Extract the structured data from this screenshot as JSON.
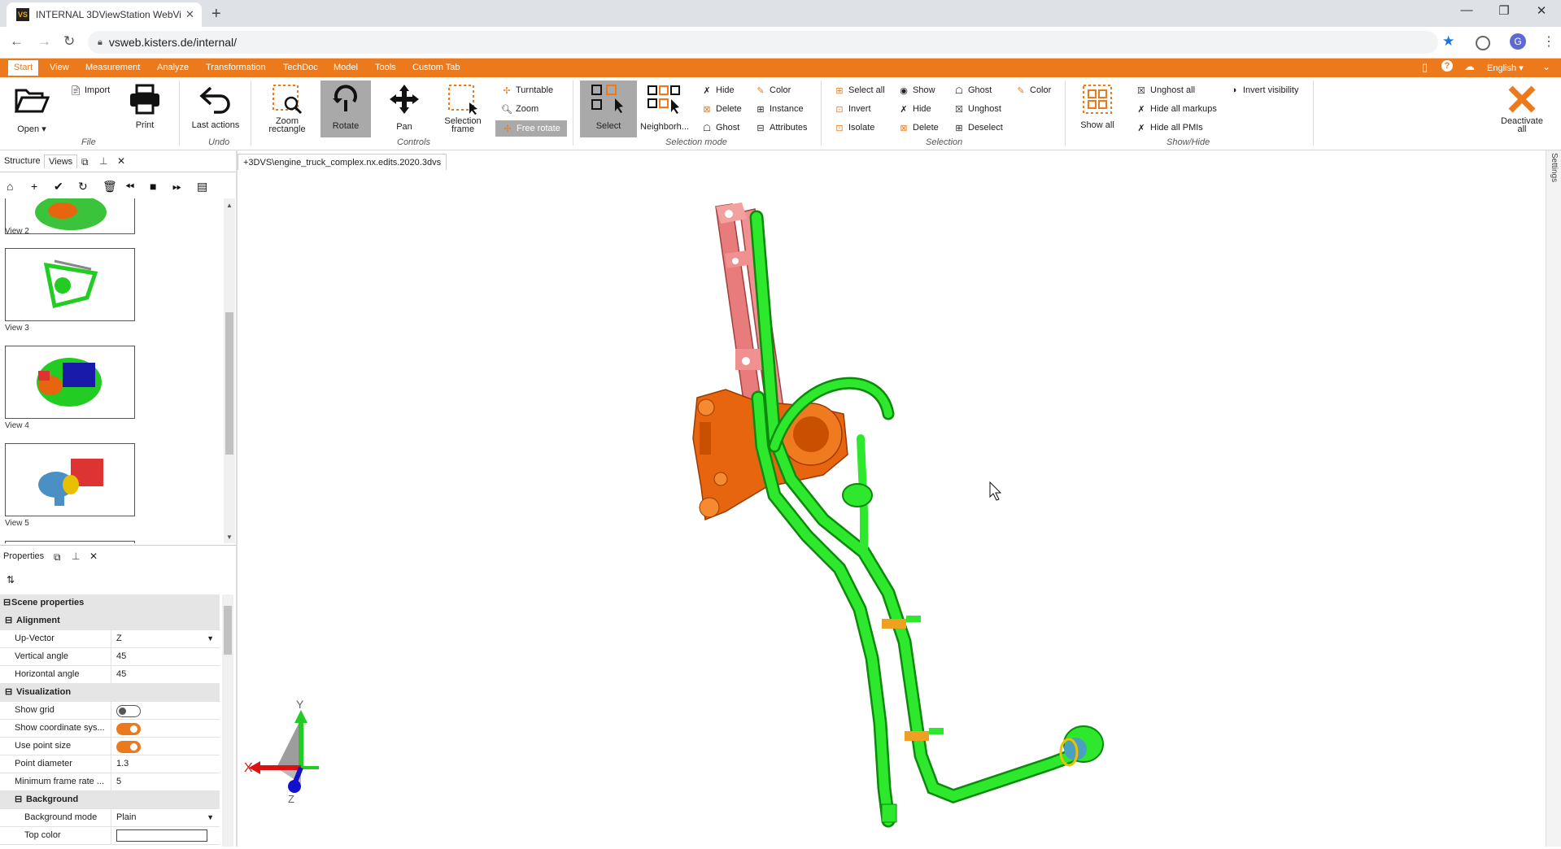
{
  "browser": {
    "tab_title": "INTERNAL 3DViewStation WebVi",
    "favicon_text": "VS",
    "url": "vsweb.kisters.de/internal/",
    "profile_initial": "G"
  },
  "menu": [
    "Start",
    "View",
    "Measurement",
    "Analyze",
    "Transformation",
    "TechDoc",
    "Model",
    "Tools",
    "Custom Tab"
  ],
  "menu_right": {
    "language": "English"
  },
  "ribbon": {
    "open": "Open",
    "import": "Import",
    "print": "Print",
    "file_group": "File",
    "last_actions": "Last actions",
    "undo_group": "Undo",
    "zoom_rectangle": "Zoom rectangle",
    "rotate": "Rotate",
    "pan": "Pan",
    "selection_frame": "Selection frame",
    "turntable": "Turntable",
    "zoom": "Zoom",
    "free_rotate": "Free rotate",
    "controls_group": "Controls",
    "select": "Select",
    "neighborh": "Neighborh...",
    "hide": "Hide",
    "delete": "Delete",
    "ghost": "Ghost",
    "color": "Color",
    "instance": "Instance",
    "attributes": "Attributes",
    "selection_mode_group": "Selection mode",
    "select_all": "Select all",
    "invert": "Invert",
    "isolate": "Isolate",
    "show": "Show",
    "hide2": "Hide",
    "delete2": "Delete",
    "ghost2": "Ghost",
    "unghost": "Unghost",
    "deselect": "Deselect",
    "color2": "Color",
    "selection_group": "Selection",
    "show_all": "Show all",
    "unghost_all": "Unghost all",
    "hide_all_markups": "Hide all markups",
    "hide_all_pmis": "Hide all PMIs",
    "invert_visibility": "Invert visibility",
    "showhide_group": "Show/Hide",
    "deactivate_all": "Deactivate all"
  },
  "panels": {
    "structure": "Structure",
    "views": "Views",
    "properties": "Properties"
  },
  "views": [
    "View 2",
    "View 3",
    "View 4",
    "View 5"
  ],
  "document_tab": "+3DVS\\engine_truck_complex.nx.edits.2020.3dvs",
  "properties": {
    "scene": "Scene properties",
    "alignment": "Alignment",
    "up_vector_k": "Up-Vector",
    "up_vector_v": "Z",
    "vertical_angle_k": "Vertical angle",
    "vertical_angle_v": "45",
    "horizontal_angle_k": "Horizontal angle",
    "horizontal_angle_v": "45",
    "visualization": "Visualization",
    "show_grid": "Show grid",
    "show_coord": "Show coordinate sys...",
    "use_point_size": "Use point size",
    "point_diameter_k": "Point diameter",
    "point_diameter_v": "1.3",
    "min_frame_rate_k": "Minimum frame rate ...",
    "min_frame_rate_v": "5",
    "background": "Background",
    "bg_mode_k": "Background mode",
    "bg_mode_v": "Plain",
    "top_color_k": "Top color"
  },
  "toggles": {
    "show_grid": false,
    "show_coord": true,
    "use_point_size": true
  },
  "axes": {
    "x": "X",
    "y": "Y",
    "z": "Z"
  },
  "side_label": "Settings",
  "colors": {
    "accent": "#ec7a1c",
    "model_green": "#22dd22",
    "model_orange": "#e8650f",
    "model_pink": "#e87b7b"
  }
}
